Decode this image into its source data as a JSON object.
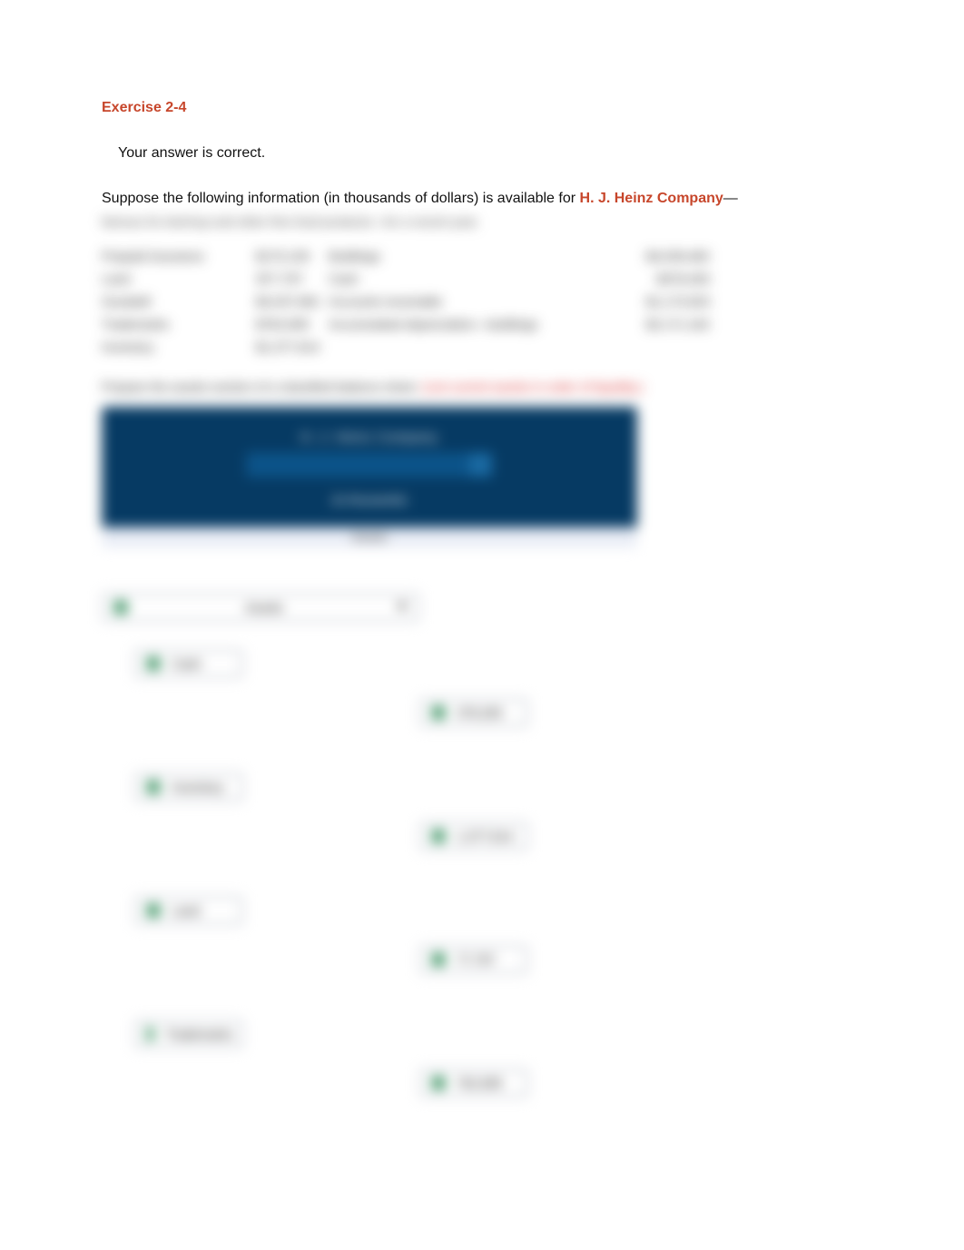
{
  "title": "Exercise 2-4",
  "checkmark_glyph": "✓",
  "correct_msg": "Your answer is correct.",
  "para_lead": "Suppose the following information (in thousands of dollars) is available for ",
  "company": "H. J. Heinz Company",
  "para_tail": "—",
  "blurred": {
    "subline": "famous for ketchup and other fine food products—for a recent year.",
    "rows": [
      {
        "l_label": "Prepaid insurance",
        "l_val": "$170,139",
        "r_label": "Buildings",
        "r_val": "$4,039,482"
      },
      {
        "l_label": "Land",
        "l_val": "$77,797",
        "r_label": "Cash",
        "r_val": "$378,283"
      },
      {
        "l_label": "Goodwill",
        "l_val": "$4,037,662",
        "r_label": "Accounts receivable",
        "r_val": "$1,173,003"
      },
      {
        "l_label": "Trademarks",
        "l_val": "$762,695",
        "r_label": "Accumulated depreciation—buildings",
        "r_val": "$2,171,162"
      },
      {
        "l_label": "Inventory",
        "l_val": "$1,377,614",
        "r_label": "",
        "r_val": ""
      }
    ],
    "instruct_black": "Prepare the assets section of a classified balance sheet.",
    "instruct_red": "(List current assets in order of liquidity.)",
    "blue_line1": "H. J. Heinz Company",
    "blue_line2": "(in thousands)",
    "grey_strip": "Assets",
    "dropdown_wide": "Assets",
    "items": [
      {
        "label": "Cash",
        "amount": "378,283"
      },
      {
        "label": "Inventory",
        "amount": "1,377,614"
      },
      {
        "label": "Land",
        "amount": "77,797"
      },
      {
        "label": "Trademarks",
        "amount": "762,695"
      }
    ]
  }
}
